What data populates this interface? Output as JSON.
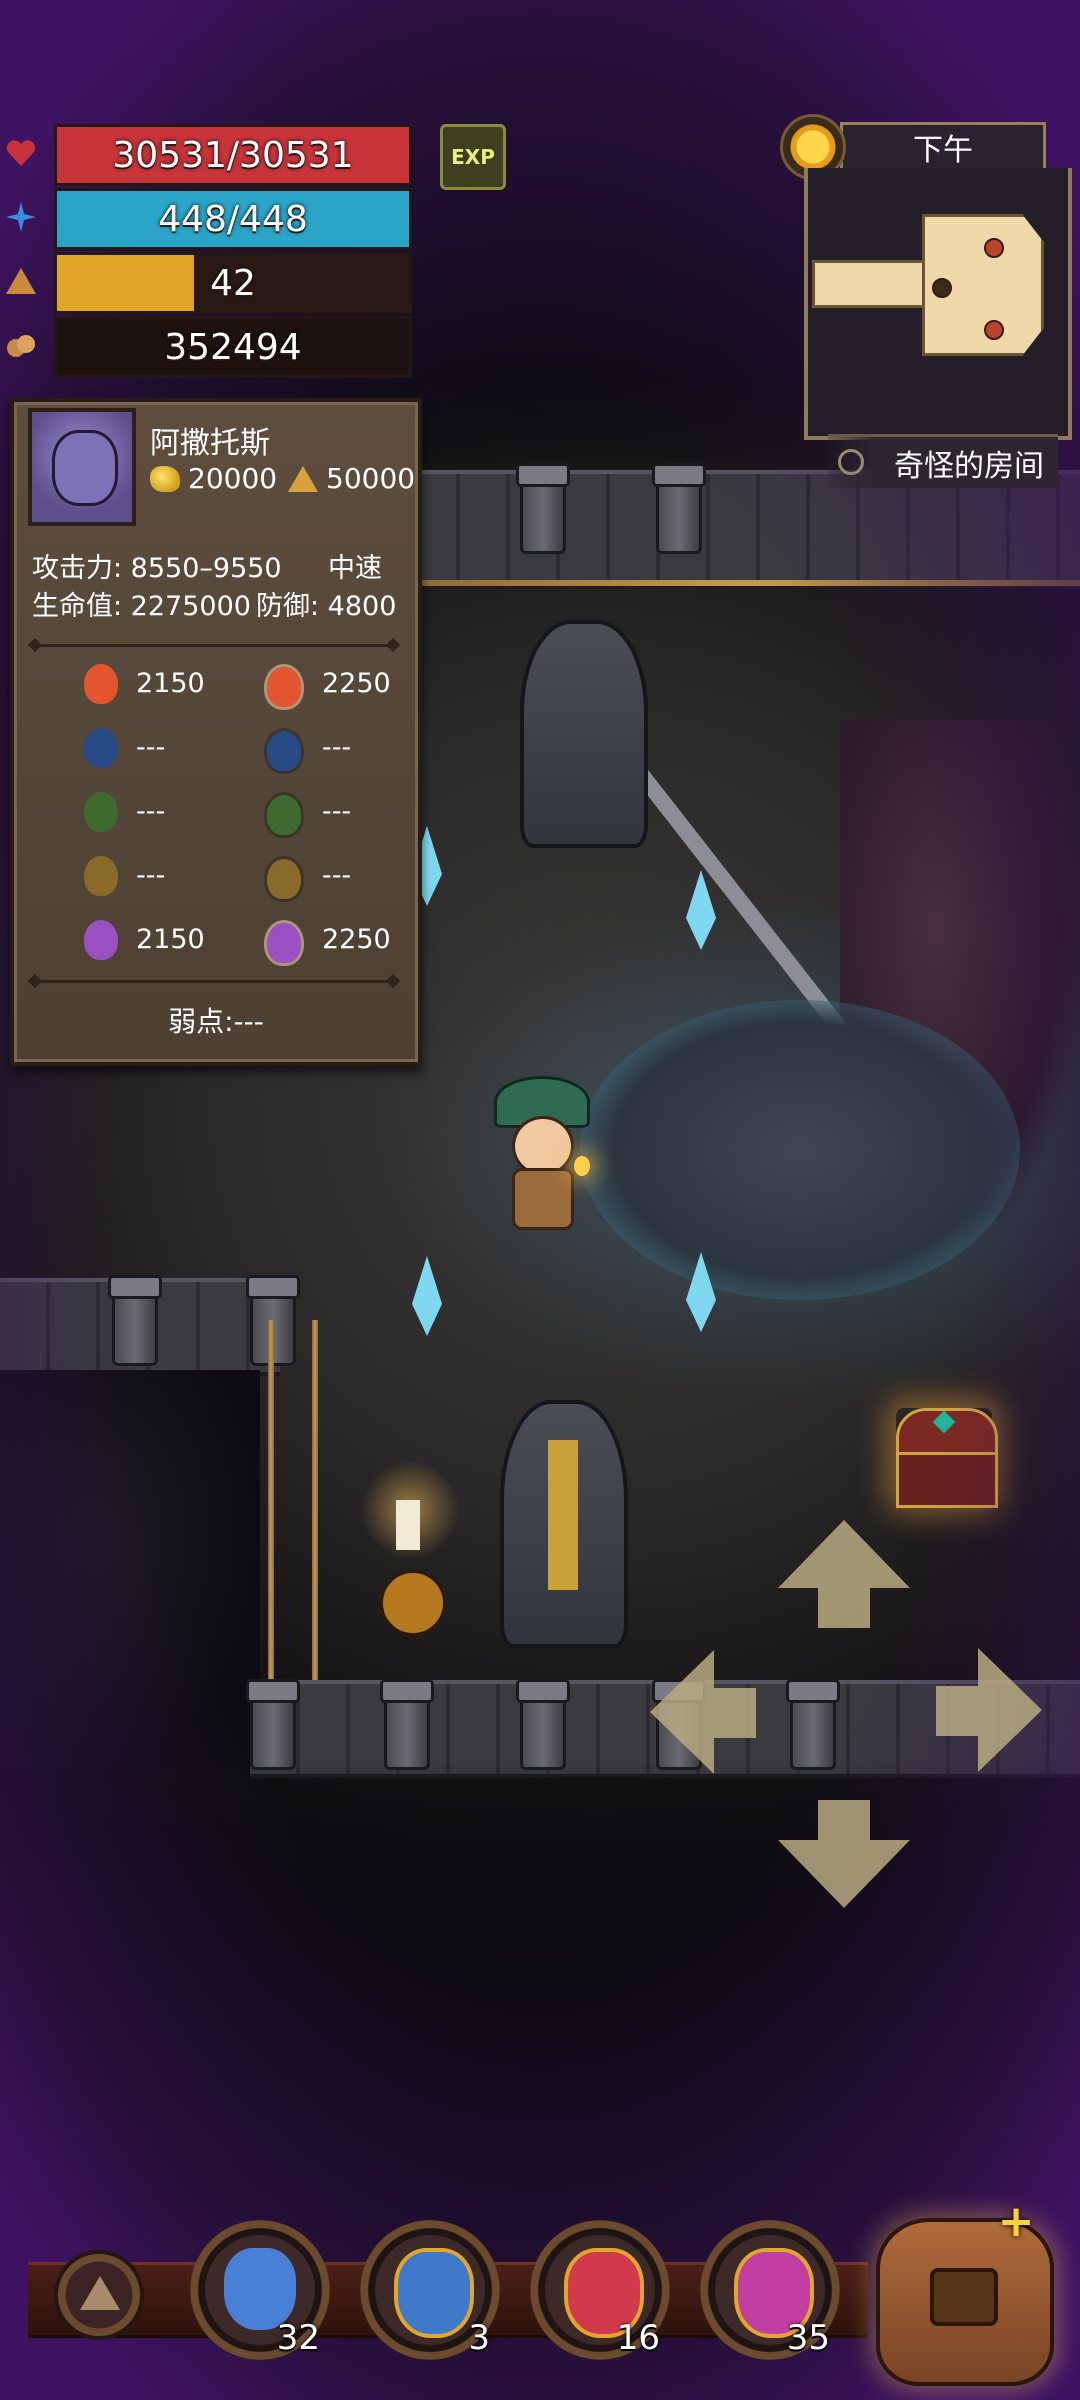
{
  "hud": {
    "hp": {
      "text": "30531/30531",
      "fraction": 1.0,
      "color": "#c7343a"
    },
    "mp": {
      "text": "448/448",
      "fraction": 1.0,
      "color": "#2aa5c8"
    },
    "level": {
      "text": "42",
      "fraction": 0.39,
      "color": "#e0a628"
    },
    "gold": {
      "text": "352494"
    },
    "exp_button": "EXP"
  },
  "minimap": {
    "time_of_day": "下午",
    "location": "奇怪的房间"
  },
  "enemy": {
    "name": "阿撒托斯",
    "gold_reward": "20000",
    "exp_reward": "50000",
    "attack_line": "攻击力: 8550–9550",
    "speed": "中速",
    "hp_line": "生命值: 2275000",
    "defense_line": "防御: 4800",
    "resistances": [
      {
        "icon": "fire-attack-icon",
        "value": "2150",
        "icon2": "fire-resist-icon",
        "value2": "2250",
        "color": "#e2552e"
      },
      {
        "icon": "water-attack-icon",
        "value": "---",
        "icon2": "water-resist-icon",
        "value2": "---",
        "color": "#274a86"
      },
      {
        "icon": "nature-attack-icon",
        "value": "---",
        "icon2": "nature-resist-icon",
        "value2": "---",
        "color": "#3f6a2f"
      },
      {
        "icon": "lightning-attack-icon",
        "value": "---",
        "icon2": "lightning-resist-icon",
        "value2": "---",
        "color": "#8a6a2a"
      },
      {
        "icon": "arcane-attack-icon",
        "value": "2150",
        "icon2": "arcane-resist-icon",
        "value2": "2250",
        "color": "#9a4fc2"
      }
    ],
    "weakness": "弱点:---"
  },
  "items": [
    {
      "name": "blue-potion",
      "count": "32",
      "color": "#4a7fd6"
    },
    {
      "name": "blue-gold-potion",
      "count": "3",
      "color": "#3e7ac9"
    },
    {
      "name": "red-potion",
      "count": "16",
      "color": "#d13a4c"
    },
    {
      "name": "pink-potion",
      "count": "35",
      "color": "#c23ea0"
    }
  ]
}
